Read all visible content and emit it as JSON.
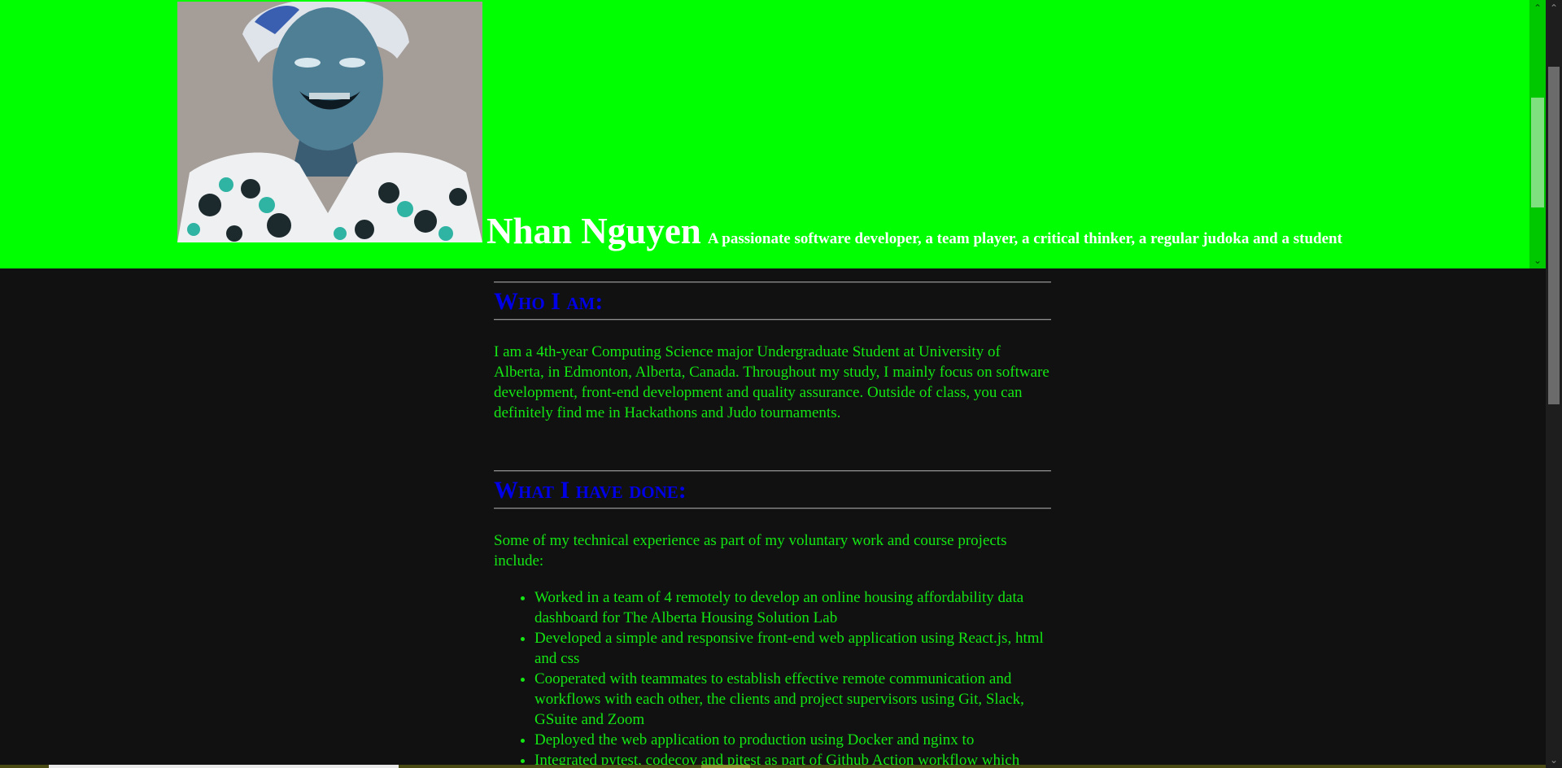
{
  "header": {
    "name": "Nhan Nguyen",
    "tagline": "A passionate software developer, a team player, a critical thinker, a regular judoka and a student"
  },
  "sections": [
    {
      "title": "Who I am:",
      "paragraph": "I am a 4th-year Computing Science major Undergraduate Student at University of Alberta, in Edmonton, Alberta, Canada. Throughout my study, I mainly focus on software development, front-end development and quality assurance. Outside of class, you can definitely find me in Hackathons and Judo tournaments."
    },
    {
      "title": "What I have done:",
      "paragraph": "Some of my technical experience as part of my voluntary work and course projects include:",
      "items": [
        "Worked in a team of 4 remotely to develop an online housing affordability data dashboard for The Alberta Housing Solution Lab",
        "Developed a simple and responsive front-end web application using React.js, html and css",
        "Cooperated with teammates to establish effective remote communication and workflows with each other, the clients and project supervisors using Git, Slack, GSuite and Zoom",
        "Deployed the web application to production using Docker and nginx to",
        "Integrated pytest, codecov and pitest as part of Github Action workflow which"
      ]
    }
  ],
  "colors": {
    "header_bg": "#00ff00",
    "page_bg": "#111111",
    "heading": "#0000e6",
    "body_text": "#14e614",
    "header_text": "#ffffff"
  },
  "icons": {
    "scroll_up": "chevron-up-icon",
    "scroll_down": "chevron-down-icon"
  }
}
